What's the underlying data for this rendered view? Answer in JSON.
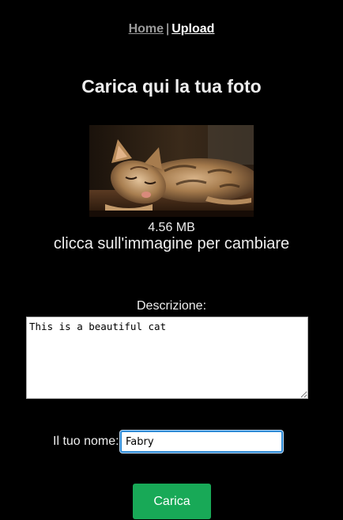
{
  "nav": {
    "home_label": "Home",
    "separator": "|",
    "upload_label": "Upload"
  },
  "page": {
    "title": "Carica qui la tua foto"
  },
  "image": {
    "subject": "sleeping tabby cat",
    "file_size": "4.56 MB",
    "change_hint": "clicca sull'immagine per cambiare"
  },
  "form": {
    "description_label": "Descrizione:",
    "description_value": "This is a beautiful cat",
    "name_label": "Il tuo nome:",
    "name_value": "Fabry",
    "submit_label": "Carica"
  },
  "colors": {
    "background": "#000000",
    "submit_button": "#18a957",
    "focus_ring": "#2e8bd6"
  }
}
